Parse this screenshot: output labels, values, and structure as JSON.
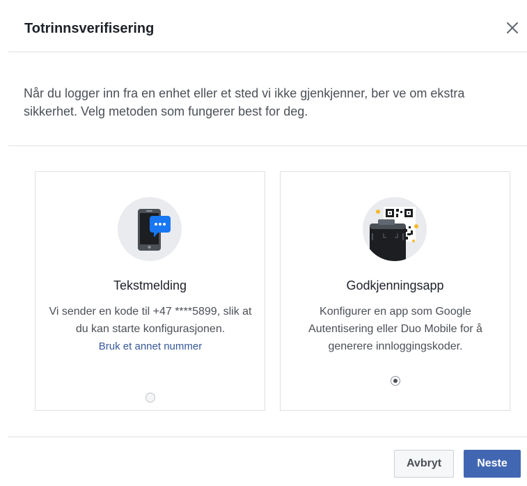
{
  "dialog": {
    "title": "Totrinnsverifisering",
    "close_icon": "close-icon"
  },
  "intro": {
    "text": "Når du logger inn fra en enhet eller et sted vi ikke gjenkjenner, ber ve om ekstra sikkerhet. Velg metoden som fungerer best for deg."
  },
  "options": [
    {
      "icon": "phone-message-icon",
      "title": "Tekstmelding",
      "description": "Vi sender en kode til +47 ****5899, slik at du kan starte konfigurasjonen.",
      "link": "Bruk et annet nummer",
      "selected": false
    },
    {
      "icon": "qr-code-phone-icon",
      "title": "Godkjenningsapp",
      "description": "Konfigurer en app som Google Autentisering eller Duo Mobile for å generere innloggingskoder.",
      "selected": true
    }
  ],
  "footer": {
    "cancel_label": "Avbryt",
    "next_label": "Neste"
  },
  "colors": {
    "primary": "#4267b2",
    "link": "#365899",
    "message_blue": "#1877f2"
  }
}
